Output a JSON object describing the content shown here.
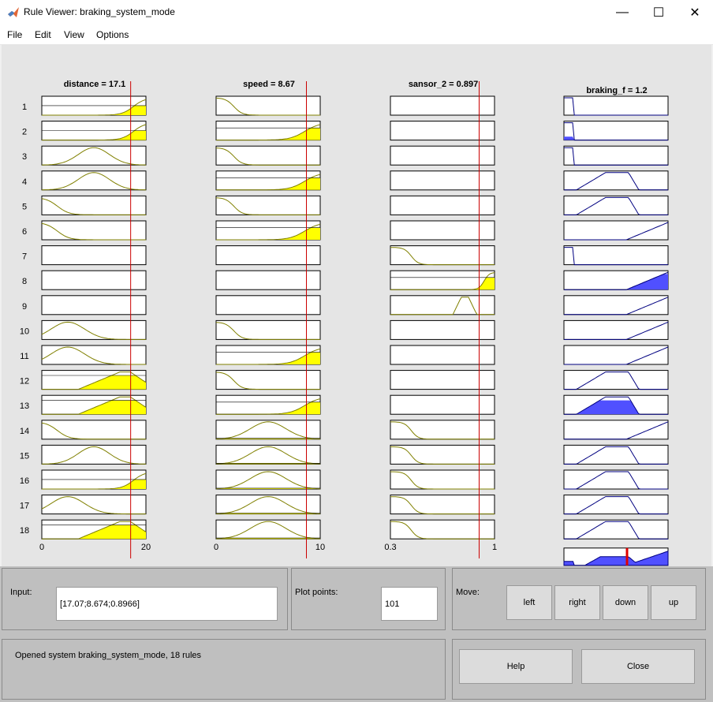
{
  "window": {
    "title": "Rule Viewer: braking_system_mode",
    "icon": "matlab-icon",
    "controls": {
      "minimize": "—",
      "maximize": "☐",
      "close": "✕"
    }
  },
  "menu": [
    "File",
    "Edit",
    "View",
    "Options"
  ],
  "inputs": [
    {
      "label": "distance = 17.1",
      "value": 17.07,
      "range": [
        0,
        20
      ],
      "tick_labels": [
        "0",
        "20"
      ]
    },
    {
      "label": "speed = 8.67",
      "value": 8.674,
      "range": [
        0,
        10
      ],
      "tick_labels": [
        "0",
        "10"
      ]
    },
    {
      "label": "sansor_2 = 0.897",
      "value": 0.8966,
      "range": [
        0.3,
        1
      ],
      "tick_labels": [
        "0.3",
        "1"
      ]
    }
  ],
  "output": {
    "label": "braking_f = 1.2",
    "value": 1.2
  },
  "rule_numbers": [
    "1",
    "2",
    "3",
    "4",
    "5",
    "6",
    "7",
    "8",
    "9",
    "10",
    "11",
    "12",
    "13",
    "14",
    "15",
    "16",
    "17",
    "18"
  ],
  "controls": {
    "input_label": "Input:",
    "input_value": "[17.07;8.674;0.8966]",
    "plot_points_label": "Plot points:",
    "plot_points_value": "101",
    "move_label": "Move:",
    "move_buttons": [
      "left",
      "right",
      "down",
      "up"
    ],
    "help_label": "Help",
    "close_label": "Close",
    "status": "Opened system braking_system_mode, 18 rules"
  },
  "colors": {
    "input_curve": "#808000",
    "input_fill": "#ffff00",
    "output_curve": "#000080",
    "output_fill": "#5050ff",
    "crosshair": "#cc0000",
    "plot_bg": "#e5e5e5"
  }
}
